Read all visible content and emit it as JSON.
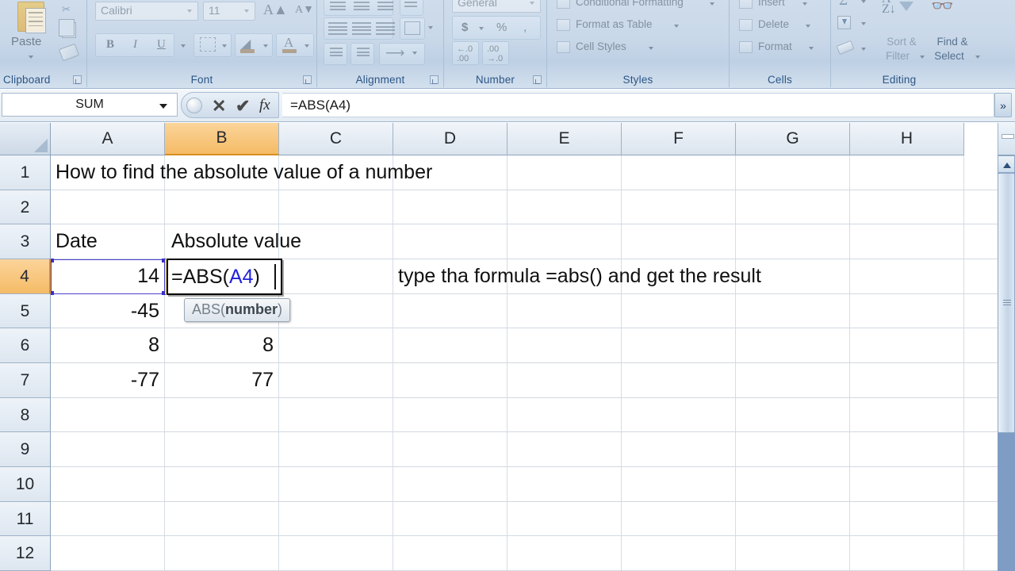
{
  "ribbon": {
    "groups": [
      {
        "label": "Clipboard"
      },
      {
        "label": "Font"
      },
      {
        "label": "Alignment"
      },
      {
        "label": "Number"
      },
      {
        "label": "Styles"
      },
      {
        "label": "Cells"
      },
      {
        "label": "Editing"
      }
    ],
    "clipboard": {
      "paste_label": "Paste"
    },
    "font": {
      "family_value": "Calibri",
      "size_value": "11",
      "bold": "B",
      "italic": "I",
      "underline": "U"
    },
    "number": {
      "format_value": "General",
      "currency": "$",
      "percent": "%",
      "comma": ",",
      "increase_decimal": ".00",
      "decrease_decimal": ".00"
    },
    "styles": {
      "conditional_formatting": "Conditional Formatting",
      "format_as_table": "Format as Table",
      "cell_styles": "Cell Styles"
    },
    "cells": {
      "insert": "Insert",
      "delete": "Delete",
      "format": "Format"
    },
    "editing": {
      "autosum": "Σ",
      "sort_filter_line1": "Sort &",
      "sort_filter_line2": "Filter",
      "find_select_line1": "Find &",
      "find_select_line2": "Select"
    }
  },
  "formula_bar": {
    "name_box_value": "SUM",
    "cancel_icon": "✕",
    "enter_icon": "✔",
    "function_icon": "fx",
    "formula_value": "=ABS(A4)",
    "expand_icon": "»"
  },
  "grid": {
    "columns": [
      "A",
      "B",
      "C",
      "D",
      "E",
      "F",
      "G",
      "H"
    ],
    "selected_column": "B",
    "rows": [
      "1",
      "2",
      "3",
      "4",
      "5",
      "6",
      "7",
      "8",
      "9",
      "10",
      "11",
      "12"
    ],
    "selected_row": "4",
    "cells": {
      "A1": "How to find the absolute value of a number",
      "A3": "Date",
      "B3": "Absolute value",
      "A4": "14",
      "A5": "-45",
      "A6": "8",
      "B6": "8",
      "A7": "-77",
      "B7": "77",
      "D4": "type tha formula =abs() and get the result"
    },
    "editing_cell": {
      "address": "B4",
      "text_prefix": "=ABS(",
      "text_reference": "A4",
      "text_suffix": ")"
    },
    "tooltip": {
      "prefix": "ABS(",
      "argument": "number",
      "suffix": ")"
    }
  },
  "colors": {
    "selection_header": "#f5bb66",
    "reference_blue": "#2222dd",
    "ribbon_blue": "#c9d8e9"
  }
}
